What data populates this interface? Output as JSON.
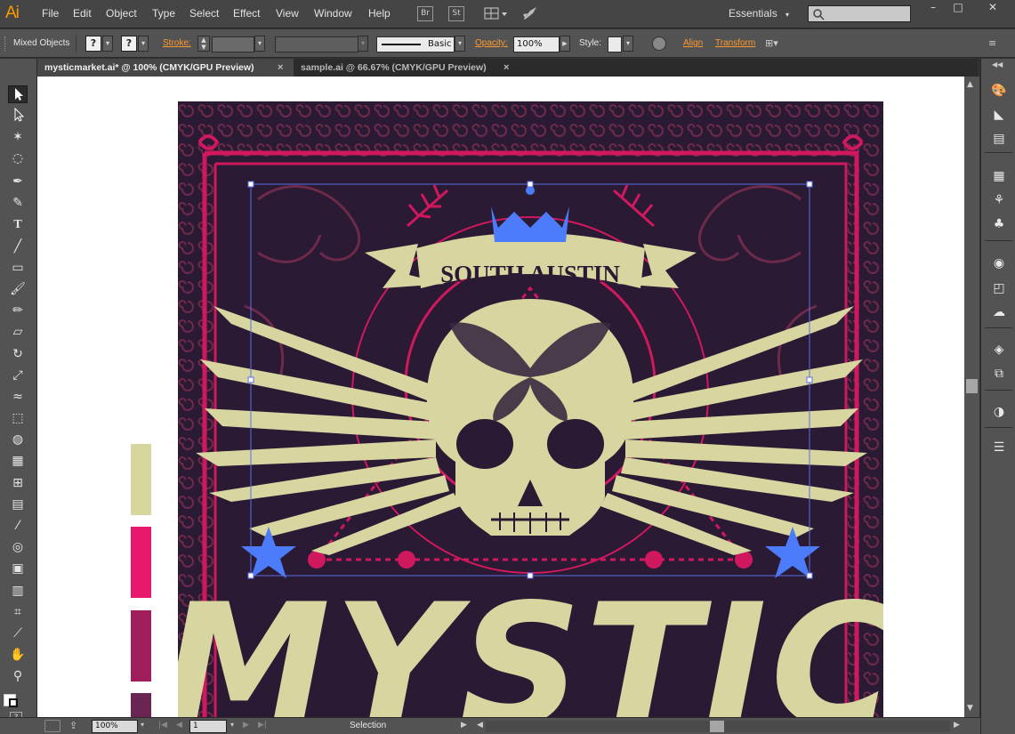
{
  "app": {
    "logo": "Ai"
  },
  "menu": [
    "File",
    "Edit",
    "Object",
    "Type",
    "Select",
    "Effect",
    "View",
    "Window",
    "Help"
  ],
  "menubar_icons": {
    "bridge": "Br",
    "stock": "St"
  },
  "workspace": {
    "label": "Essentials"
  },
  "control_bar": {
    "selection_label": "Mixed Objects",
    "fill_value": "?",
    "stroke_value": "?",
    "stroke_label": "Stroke:",
    "brush_label": "Basic",
    "opacity_label": "Opacity:",
    "opacity_value": "100%",
    "style_label": "Style:",
    "align_label": "Align",
    "transform_label": "Transform"
  },
  "tabs": [
    {
      "label": "mysticmarket.ai* @ 100% (CMYK/GPU Preview)",
      "active": true
    },
    {
      "label": "sample.ai @ 66.67% (CMYK/GPU Preview)",
      "active": false
    }
  ],
  "artwork": {
    "banner_text": "SOUTH AUSTIN",
    "title_text": "MYSTIC"
  },
  "swatches": [
    {
      "name": "cream",
      "color": "#d6d69e"
    },
    {
      "name": "pink",
      "color": "#e8186a"
    },
    {
      "name": "magenta",
      "color": "#9e1d5a"
    },
    {
      "name": "plum",
      "color": "#6b2552"
    }
  ],
  "colors": {
    "art_background": "#2a1a33",
    "frame_pink": "#d0185e",
    "ornament": "#6e2a4a",
    "cream": "#d7d5a0",
    "star_blue": "#4d7cfa",
    "selection": "#5a6ee8"
  },
  "status": {
    "zoom": "100%",
    "page": "1",
    "tool": "Selection"
  }
}
